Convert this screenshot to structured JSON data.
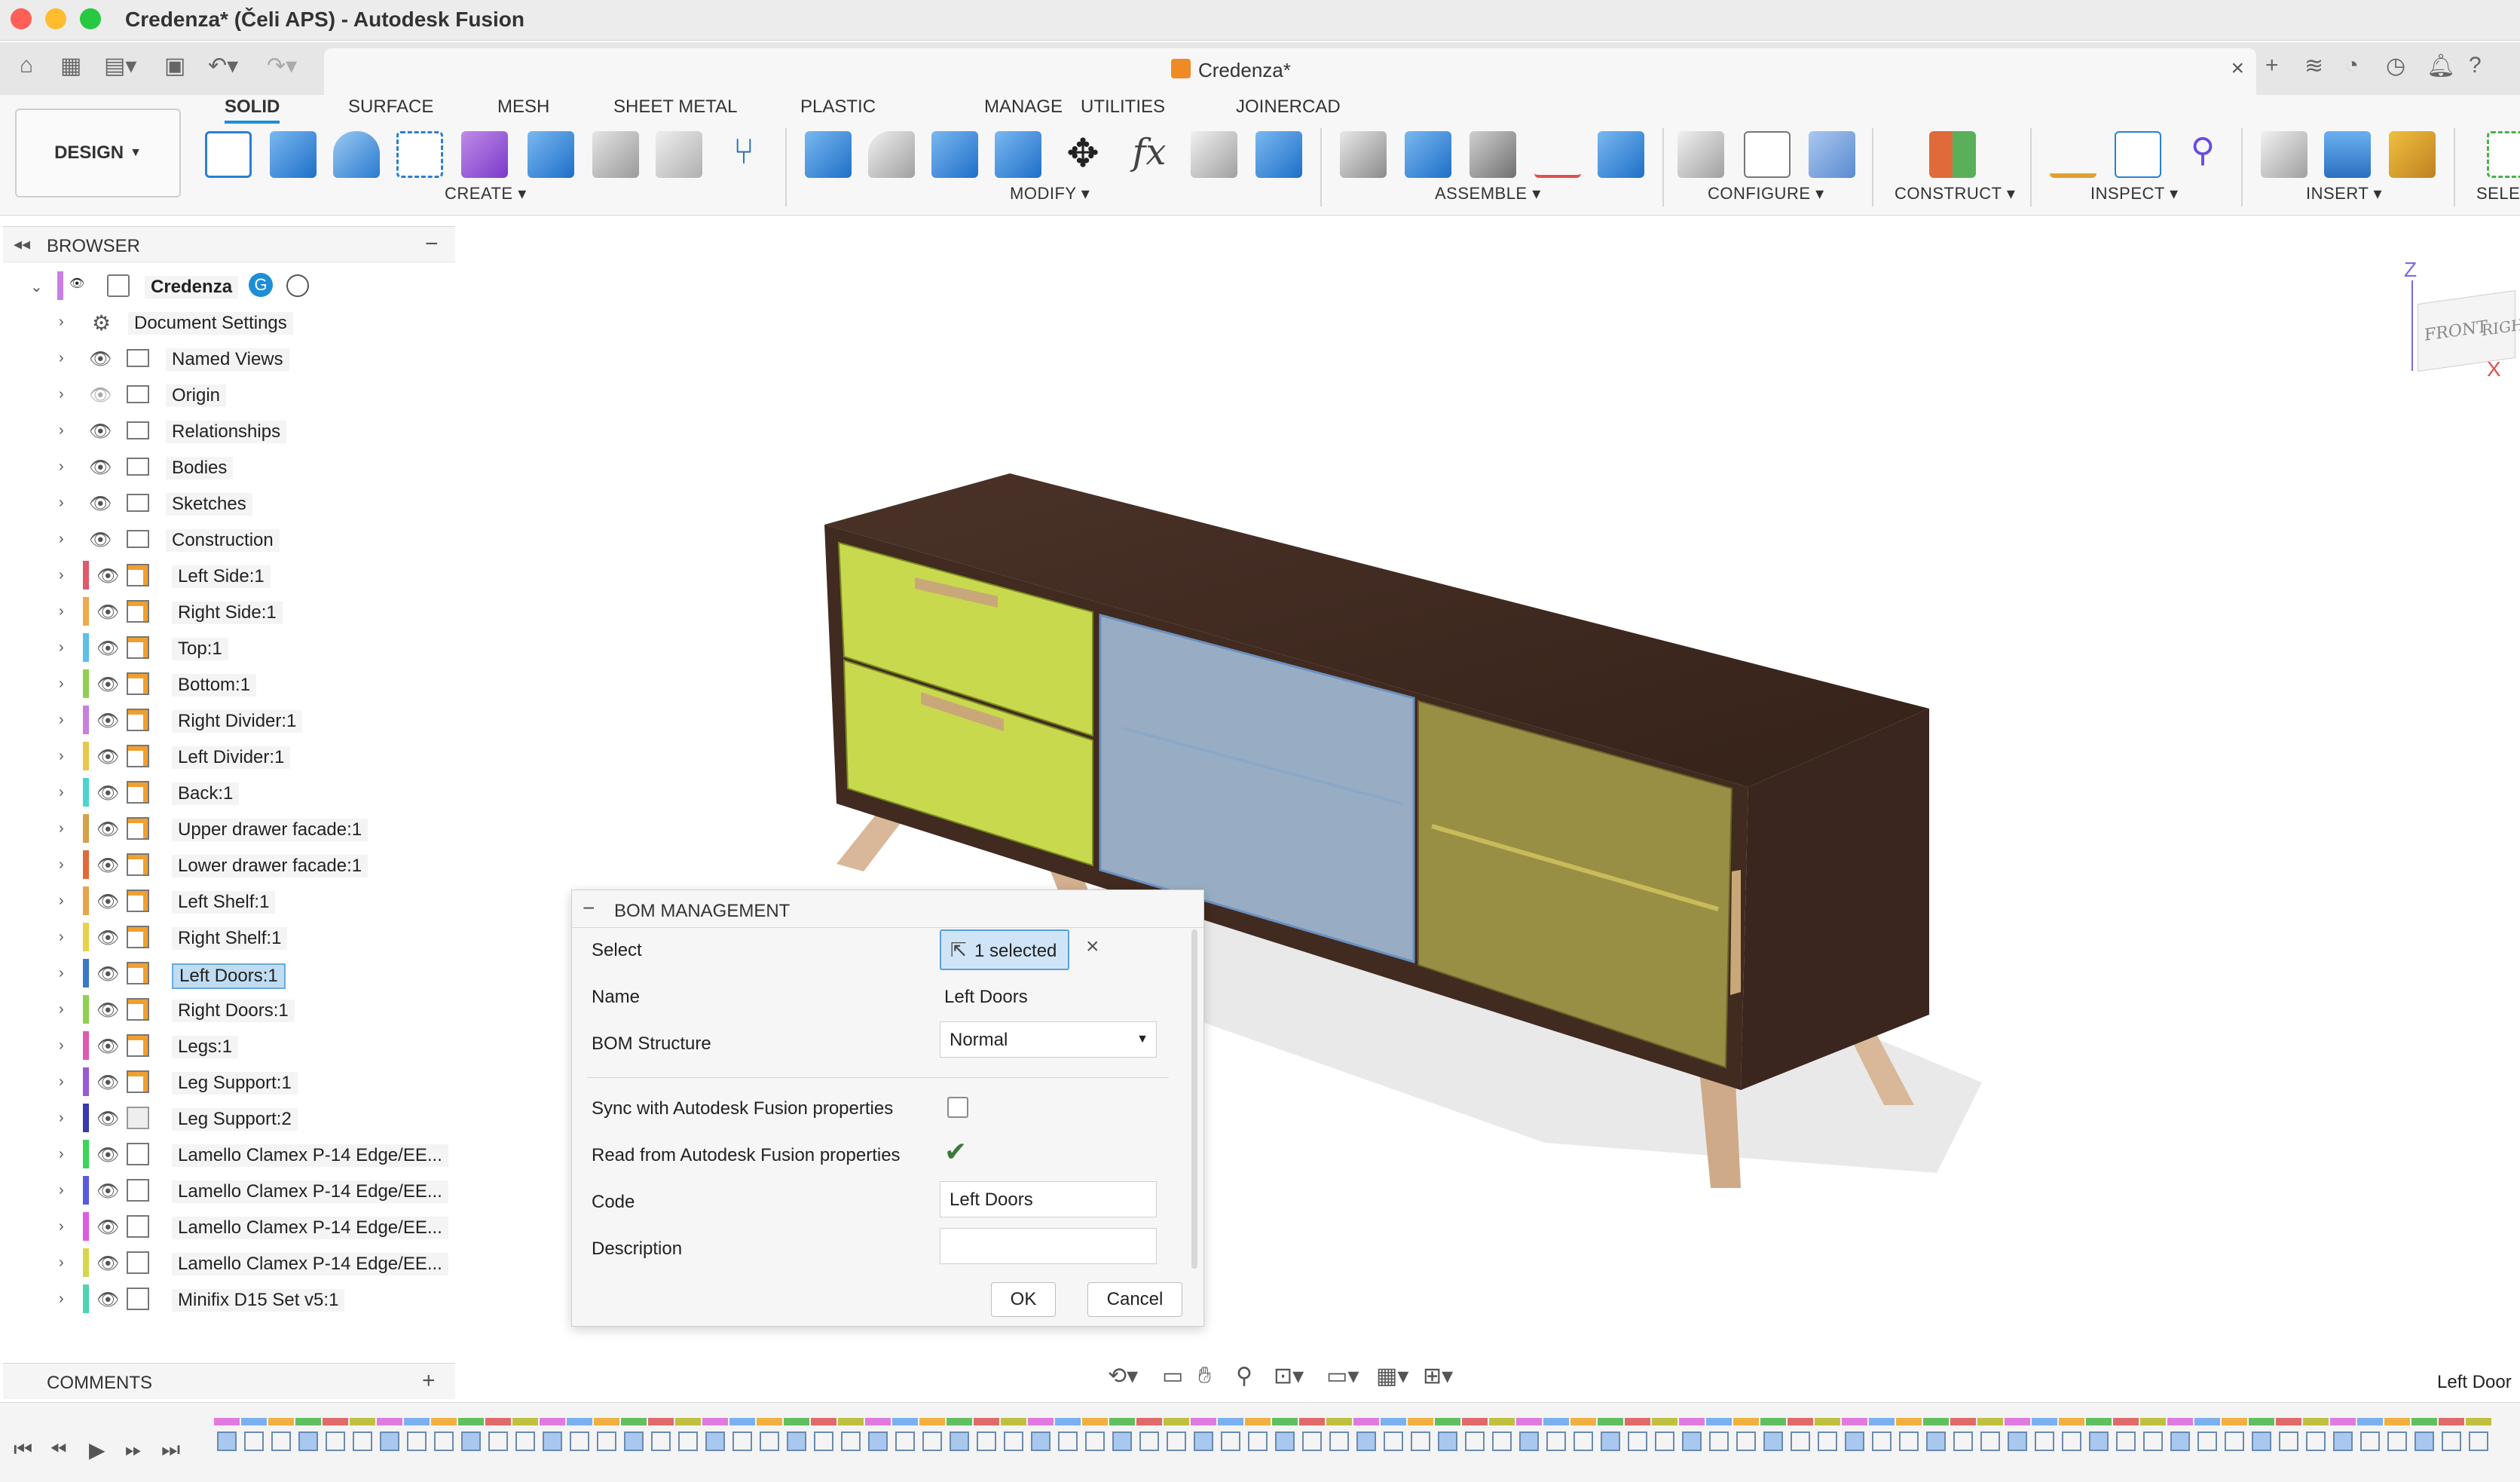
{
  "window": {
    "title": "Credenza* (Čeli APS) - Autodesk Fusion",
    "document_tab": "Credenza*"
  },
  "ribbon": {
    "workspace": "DESIGN",
    "tabs": [
      "SOLID",
      "SURFACE",
      "MESH",
      "SHEET METAL",
      "PLASTIC",
      "MANAGE",
      "UTILITIES",
      "JOINERCAD"
    ],
    "active_tab": "SOLID",
    "groups": [
      "CREATE",
      "MODIFY",
      "ASSEMBLE",
      "CONFIGURE",
      "CONSTRUCT",
      "INSPECT",
      "INSERT",
      "SELEC"
    ]
  },
  "browser": {
    "title": "BROWSER",
    "root": "Credenza",
    "items": [
      {
        "label": "Document Settings",
        "kind": "gear",
        "color": ""
      },
      {
        "label": "Named Views",
        "kind": "folder",
        "color": ""
      },
      {
        "label": "Origin",
        "kind": "folder-hidden",
        "color": ""
      },
      {
        "label": "Relationships",
        "kind": "folder",
        "color": ""
      },
      {
        "label": "Bodies",
        "kind": "folder",
        "color": ""
      },
      {
        "label": "Sketches",
        "kind": "folder",
        "color": ""
      },
      {
        "label": "Construction",
        "kind": "folder",
        "color": ""
      },
      {
        "label": "Left Side:1",
        "kind": "comp",
        "color": "#e05a6a"
      },
      {
        "label": "Right Side:1",
        "kind": "comp",
        "color": "#f0a94a"
      },
      {
        "label": "Top:1",
        "kind": "comp",
        "color": "#5cc0e8"
      },
      {
        "label": "Bottom:1",
        "kind": "comp",
        "color": "#8fd14f"
      },
      {
        "label": "Right Divider:1",
        "kind": "comp",
        "color": "#c77fe0"
      },
      {
        "label": "Left Divider:1",
        "kind": "comp",
        "color": "#e8c84a"
      },
      {
        "label": "Back:1",
        "kind": "comp",
        "color": "#4ad6d0"
      },
      {
        "label": "Upper drawer facade:1",
        "kind": "comp",
        "color": "#d6a24a"
      },
      {
        "label": "Lower drawer facade:1",
        "kind": "comp",
        "color": "#e06a3a"
      },
      {
        "label": "Left Shelf:1",
        "kind": "comp",
        "color": "#e8a44a"
      },
      {
        "label": "Right Shelf:1",
        "kind": "comp",
        "color": "#e8d24a"
      },
      {
        "label": "Left Doors:1",
        "kind": "comp",
        "color": "#3a78c8"
      },
      {
        "label": "Right Doors:1",
        "kind": "comp",
        "color": "#8fd14f"
      },
      {
        "label": "Legs:1",
        "kind": "comp",
        "color": "#e05ab0"
      },
      {
        "label": "Leg Support:1",
        "kind": "comp",
        "color": "#9a5ad6"
      },
      {
        "label": "Leg Support:2",
        "kind": "body",
        "color": "#3a3ab0"
      },
      {
        "label": "Lamello Clamex P-14 Edge/EE...",
        "kind": "asm",
        "color": "#3ad65a"
      },
      {
        "label": "Lamello Clamex P-14 Edge/EE...",
        "kind": "asm",
        "color": "#5a5ae0"
      },
      {
        "label": "Lamello Clamex P-14 Edge/EE...",
        "kind": "asm",
        "color": "#e05ae0"
      },
      {
        "label": "Lamello Clamex P-14 Edge/EE...",
        "kind": "asm",
        "color": "#d6d64a"
      },
      {
        "label": "Minifix D15 Set v5:1",
        "kind": "asm",
        "color": "#4ad6b0"
      }
    ],
    "selected_item": "Left Doors:1"
  },
  "comments": {
    "title": "COMMENTS"
  },
  "bom": {
    "title": "BOM MANAGEMENT",
    "select_label": "Select",
    "select_value": "1 selected",
    "name_label": "Name",
    "name_value": "Left Doors",
    "structure_label": "BOM Structure",
    "structure_value": "Normal",
    "sync_label": "Sync with Autodesk Fusion properties",
    "sync_checked": false,
    "read_label": "Read from Autodesk Fusion properties",
    "read_checked": true,
    "code_label": "Code",
    "code_value": "Left Doors",
    "description_label": "Description",
    "description_value": "",
    "ok_label": "OK",
    "cancel_label": "Cancel"
  },
  "viewcube": {
    "front": "FRONT",
    "right": "RIGHT",
    "axis_z": "Z",
    "axis_x": "X"
  },
  "status": {
    "hover_text": "Left Door"
  },
  "colors": {
    "accent": "#1e8fd6",
    "cabinet_wood": "#3e2a22",
    "drawer_lime": "#c9d94e",
    "glass_blue": "#a8c4e0",
    "right_door_olive": "#a39a48",
    "legs_oak": "#d8b898"
  }
}
